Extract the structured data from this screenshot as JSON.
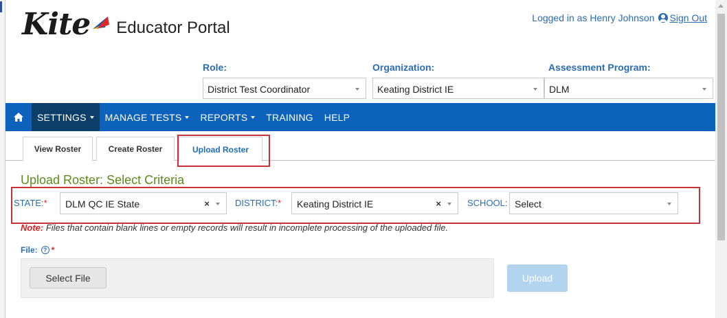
{
  "app": {
    "logo_text": "Kite",
    "portal_name": "Educator Portal"
  },
  "user": {
    "logged_in_text": "Logged in as Henry Johnson",
    "sign_out_label": "Sign Out"
  },
  "selectors": {
    "role": {
      "label": "Role:",
      "value": "District Test Coordinator"
    },
    "organization": {
      "label": "Organization:",
      "value": "Keating District IE"
    },
    "assessment_program": {
      "label": "Assessment Program:",
      "value": "DLM"
    }
  },
  "nav": {
    "home_icon": "home-icon",
    "items": [
      {
        "label": "SETTINGS",
        "dropdown": true,
        "active": true
      },
      {
        "label": "MANAGE TESTS",
        "dropdown": true,
        "active": false
      },
      {
        "label": "REPORTS",
        "dropdown": true,
        "active": false
      },
      {
        "label": "TRAINING",
        "dropdown": false,
        "active": false
      },
      {
        "label": "HELP",
        "dropdown": false,
        "active": false
      }
    ]
  },
  "tabs": [
    {
      "label": "View Roster",
      "active": false
    },
    {
      "label": "Create Roster",
      "active": false
    },
    {
      "label": "Upload Roster",
      "active": true
    }
  ],
  "page": {
    "section_title": "Upload Roster: Select Criteria"
  },
  "criteria": {
    "state": {
      "label": "STATE:",
      "required": "*",
      "value": "DLM QC IE State",
      "clear": "×"
    },
    "district": {
      "label": "DISTRICT:",
      "required": "*",
      "value": "Keating District IE",
      "clear": "×"
    },
    "school": {
      "label": "SCHOOL:",
      "value": "Select"
    }
  },
  "note": {
    "prefix": "Note:",
    "text": " Files that contain blank lines or empty records will result in incomplete processing of the uploaded file."
  },
  "file": {
    "label": "File:",
    "help_glyph": "?",
    "required": "*",
    "select_button": "Select File",
    "upload_button": "Upload"
  },
  "colors": {
    "nav_bg": "#0d63bb",
    "nav_active_bg": "#0b3f6a",
    "link_blue": "#2a6cb6",
    "title_green": "#5d8a1e",
    "highlight_red": "#c7313a",
    "required_red": "#e02020",
    "upload_disabled": "#b2d4ef"
  }
}
